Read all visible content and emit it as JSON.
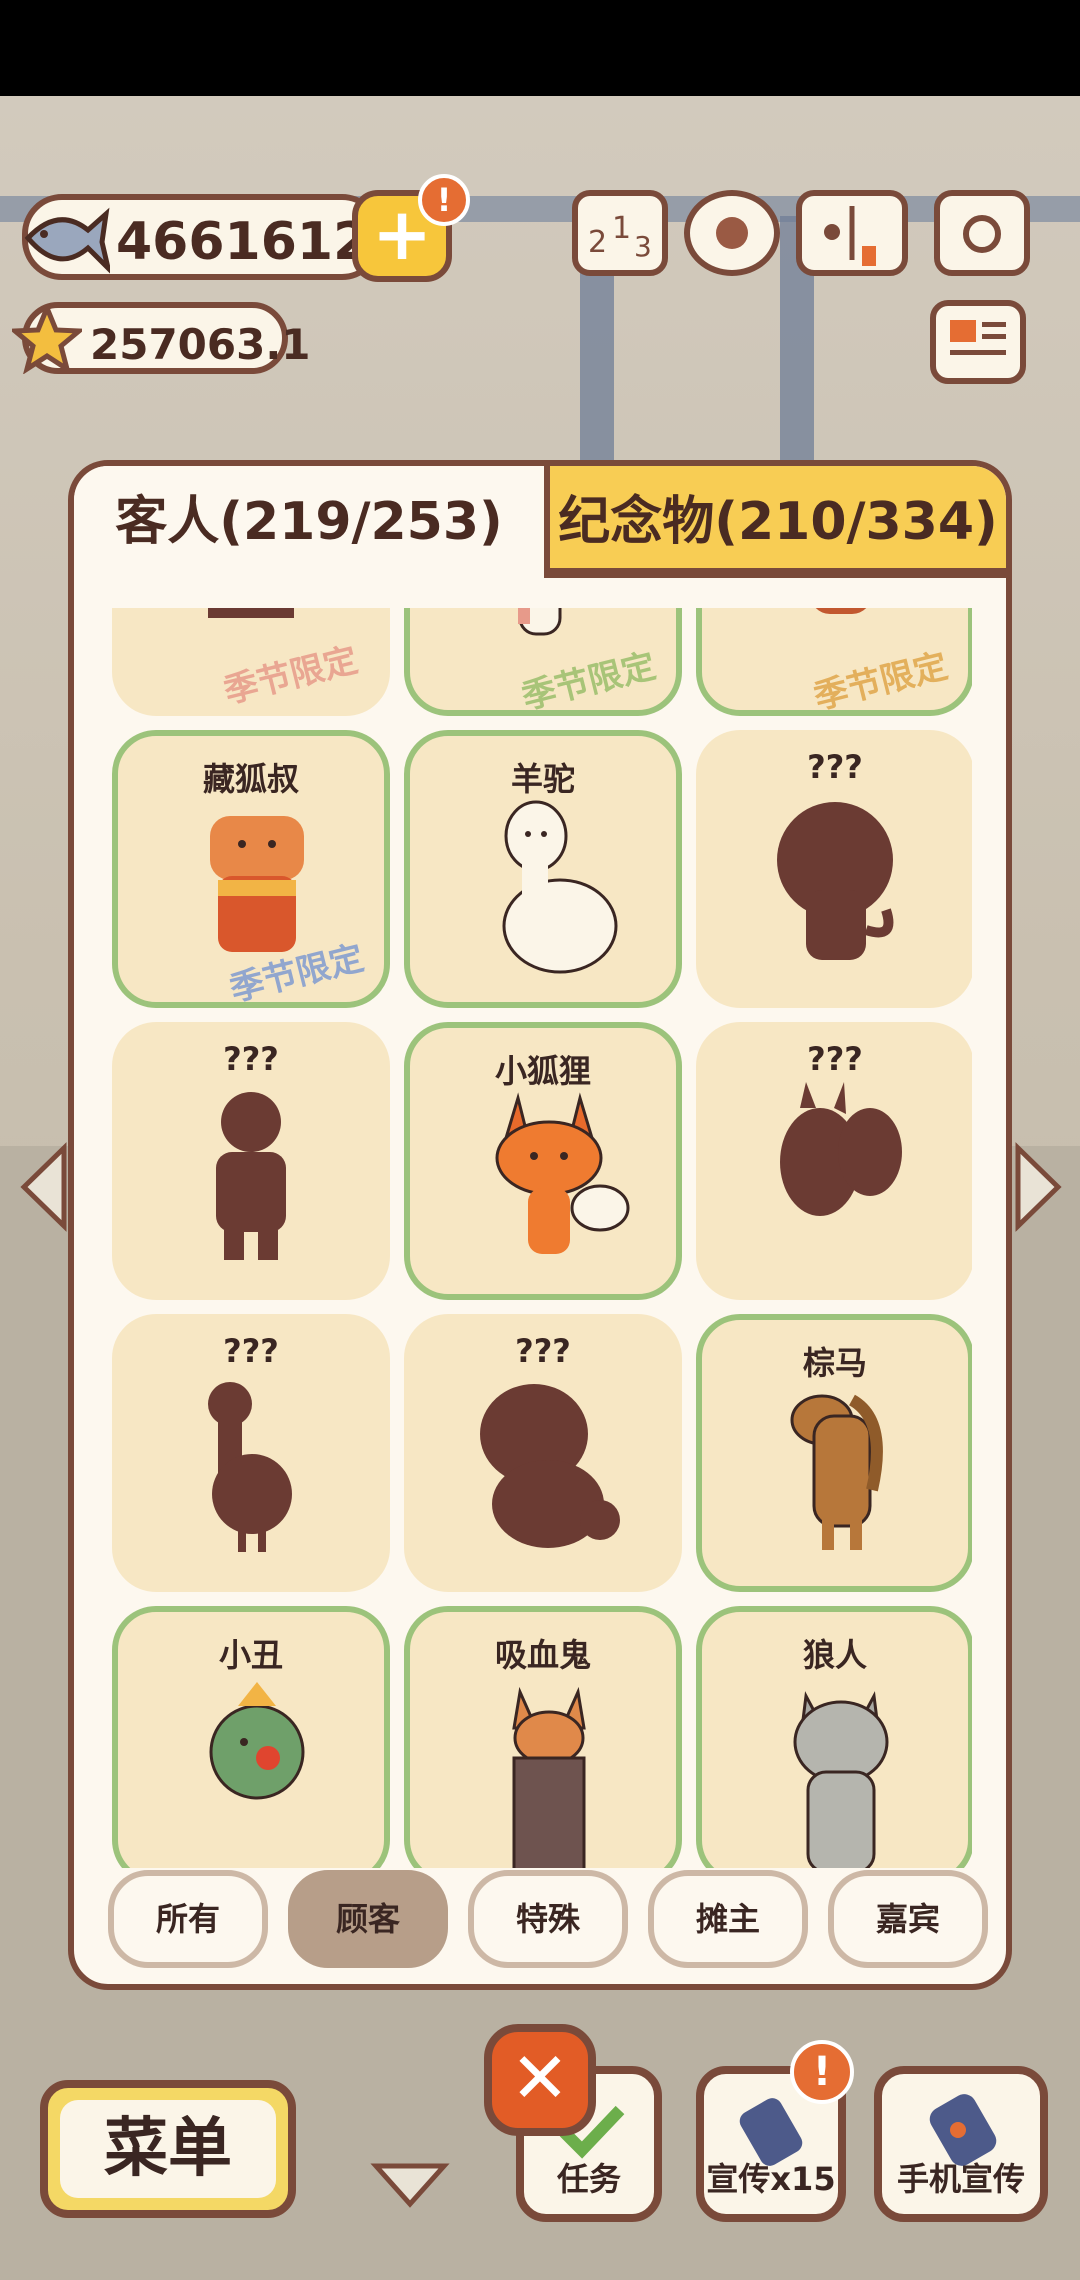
{
  "hud": {
    "fish_count": "4661612",
    "star_count": "257063.1",
    "plus_symbol": "+",
    "alert_symbol": "!"
  },
  "tabs": [
    {
      "label": "客人(219/253)",
      "active": true
    },
    {
      "label": "纪念物(210/334)",
      "active": false
    }
  ],
  "cards": [
    {
      "name": "",
      "owned": false,
      "silhouette": true,
      "stamp": "季节限定",
      "stamp_color": "#e79a8a"
    },
    {
      "name": "",
      "owned": true,
      "silhouette": false,
      "stamp": "季节限定",
      "stamp_color": "#9bbf6b"
    },
    {
      "name": "",
      "owned": true,
      "silhouette": false,
      "stamp": "季节限定",
      "stamp_color": "#e0a64a"
    },
    {
      "name": "藏狐叔",
      "owned": true,
      "silhouette": false,
      "stamp": "季节限定",
      "stamp_color": "#7f9ad1"
    },
    {
      "name": "羊驼",
      "owned": true,
      "silhouette": false,
      "stamp": ""
    },
    {
      "name": "???",
      "owned": false,
      "silhouette": true,
      "stamp": ""
    },
    {
      "name": "???",
      "owned": false,
      "silhouette": true,
      "stamp": ""
    },
    {
      "name": "小狐狸",
      "owned": true,
      "silhouette": false,
      "stamp": ""
    },
    {
      "name": "???",
      "owned": false,
      "silhouette": true,
      "stamp": ""
    },
    {
      "name": "???",
      "owned": false,
      "silhouette": true,
      "stamp": ""
    },
    {
      "name": "???",
      "owned": false,
      "silhouette": true,
      "stamp": ""
    },
    {
      "name": "棕马",
      "owned": true,
      "silhouette": false,
      "stamp": ""
    },
    {
      "name": "小丑",
      "owned": true,
      "silhouette": false,
      "stamp": ""
    },
    {
      "name": "吸血鬼",
      "owned": true,
      "silhouette": false,
      "stamp": ""
    },
    {
      "name": "狼人",
      "owned": true,
      "silhouette": false,
      "stamp": ""
    }
  ],
  "filters": [
    {
      "label": "所有",
      "active": false
    },
    {
      "label": "顾客",
      "active": true
    },
    {
      "label": "特殊",
      "active": false
    },
    {
      "label": "摊主",
      "active": false
    },
    {
      "label": "嘉宾",
      "active": false
    }
  ],
  "bottom": {
    "menu_label": "菜单",
    "close_symbol": "✕",
    "tasks_label": "任务",
    "promote_label": "宣传x15",
    "phone_promote_label": "手机宣传"
  },
  "colors": {
    "owned_border": "#9cc37b",
    "card_bg": "#f7e7c4",
    "silhouette": "#6b3b33",
    "accent_yellow": "#f8cd54",
    "outline_brown": "#7a4a3a"
  }
}
